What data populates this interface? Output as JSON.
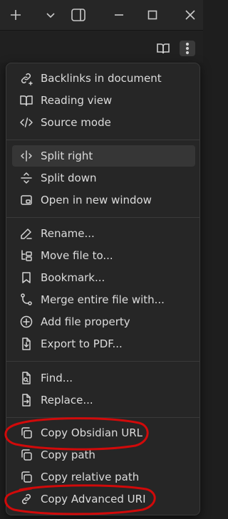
{
  "titlebar": {
    "icons": [
      "plus-icon",
      "chevron-down-icon",
      "sidebar-toggle-icon",
      "minimize-icon",
      "maximize-icon",
      "close-icon"
    ]
  },
  "viewbar": {
    "icons": [
      "book-open-icon",
      "more-options-icon"
    ]
  },
  "menu": {
    "items": [
      {
        "label": "Backlinks in document",
        "icon": "backlinks-icon"
      },
      {
        "label": "Reading view",
        "icon": "book-open-icon"
      },
      {
        "label": "Source mode",
        "icon": "code-icon"
      },
      {
        "label": "Split right",
        "icon": "split-vertical-icon"
      },
      {
        "label": "Split down",
        "icon": "split-horizontal-icon"
      },
      {
        "label": "Open in new window",
        "icon": "new-window-icon"
      },
      {
        "label": "Rename...",
        "icon": "pencil-icon"
      },
      {
        "label": "Move file to...",
        "icon": "folder-tree-icon"
      },
      {
        "label": "Bookmark...",
        "icon": "bookmark-icon"
      },
      {
        "label": "Merge entire file with...",
        "icon": "git-merge-icon"
      },
      {
        "label": "Add file property",
        "icon": "plus-circle-icon"
      },
      {
        "label": "Export to PDF...",
        "icon": "file-export-icon"
      },
      {
        "label": "Find...",
        "icon": "file-search-icon"
      },
      {
        "label": "Replace...",
        "icon": "file-replace-icon"
      },
      {
        "label": "Copy Obsidian URL",
        "icon": "copy-icon"
      },
      {
        "label": "Copy path",
        "icon": "copy-icon"
      },
      {
        "label": "Copy relative path",
        "icon": "copy-icon"
      },
      {
        "label": "Copy Advanced URI",
        "icon": "link-icon"
      }
    ]
  },
  "colors": {
    "background": "#1e1e1e",
    "menu_background": "#262626",
    "hover_background": "#363636",
    "text": "#dcdcdc",
    "annotation_red": "#d10a0a"
  }
}
